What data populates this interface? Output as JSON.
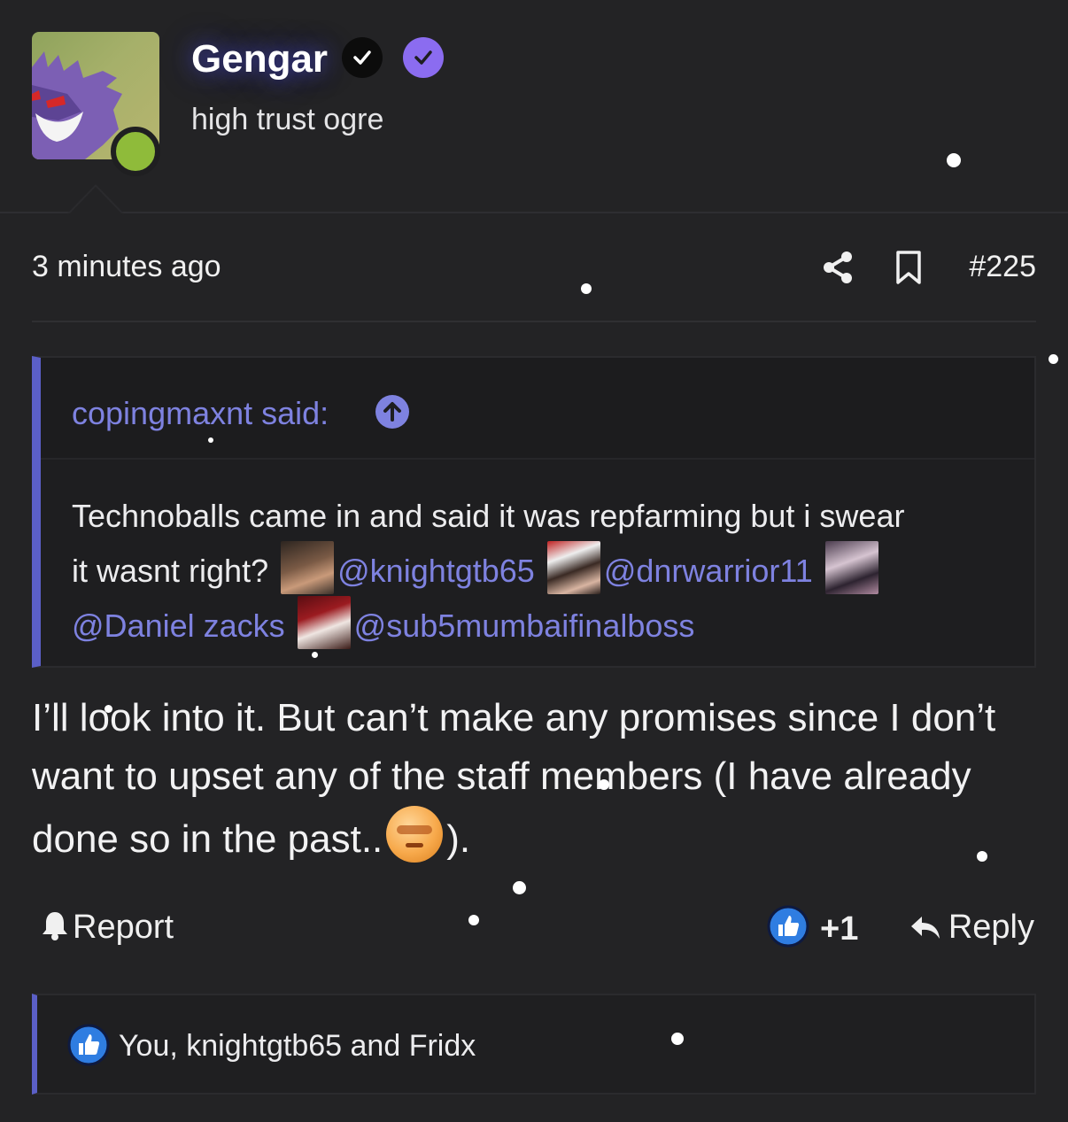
{
  "author": {
    "name": "Gengar",
    "title": "high trust ogre",
    "online": true
  },
  "post": {
    "time": "3 minutes ago",
    "number": "#225"
  },
  "quote": {
    "author_label": "copingmaxnt said:",
    "text_line1": "Technoballs came in and said it was repfarming but i swear",
    "text_line2_start": "it wasnt right?",
    "mentions": [
      "@knightgtb65",
      "@dnrwarrior11",
      "@Daniel zacks",
      "@sub5mumbaifinalboss"
    ]
  },
  "reply": {
    "text_main": "I’ll look into it. But can’t make any promises since I don’t want to upset any of the staff members (I have already done so in the past..",
    "text_end": ")."
  },
  "actions": {
    "report_label": "Report",
    "like_count": "+1",
    "reply_label": "Reply"
  },
  "reactions": {
    "text": "You, knightgtb65 and Fridx"
  },
  "colors": {
    "background": "#232325",
    "accent": "#5b5fc7",
    "mention": "#7e82e0",
    "online": "#8fbb3a",
    "verified": "#8b6cf0"
  },
  "icons": [
    "verified-black-icon",
    "verified-purple-icon",
    "share-icon",
    "bookmark-icon",
    "quote-jump-icon",
    "bell-icon",
    "like-icon",
    "reply-arrow-icon"
  ]
}
